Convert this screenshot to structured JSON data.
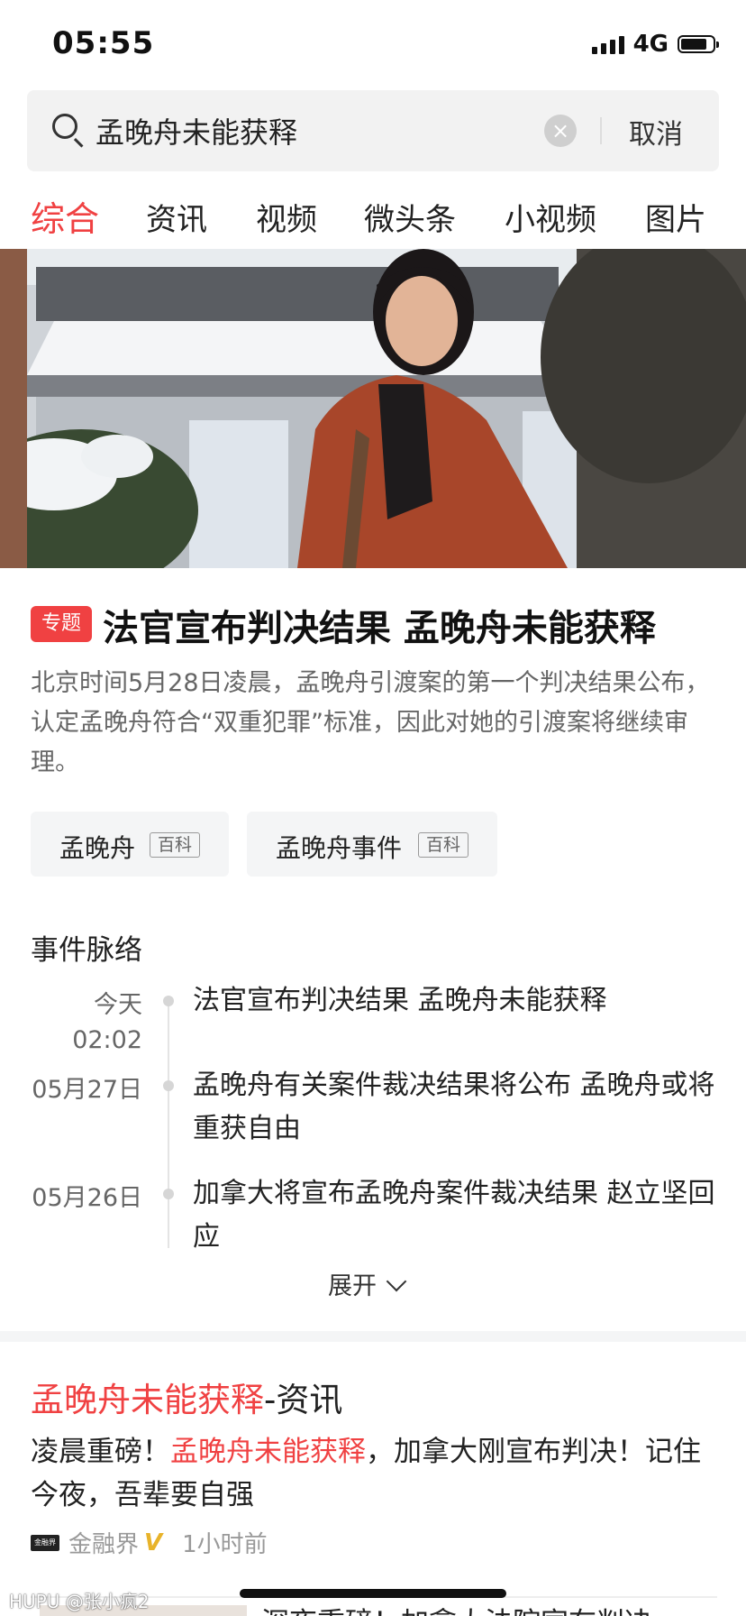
{
  "status_bar": {
    "time": "05:55",
    "network": "4G"
  },
  "search": {
    "query": "孟晚舟未能获释",
    "clear_glyph": "×",
    "cancel_label": "取消"
  },
  "tabs": [
    {
      "label": "综合",
      "active": true
    },
    {
      "label": "资讯",
      "active": false
    },
    {
      "label": "视频",
      "active": false
    },
    {
      "label": "微头条",
      "active": false
    },
    {
      "label": "小视频",
      "active": false
    },
    {
      "label": "图片",
      "active": false
    }
  ],
  "topic": {
    "tag": "专题",
    "title": "法官宣布判决结果 孟晚舟未能获释",
    "summary": "北京时间5月28日凌晨，孟晚舟引渡案的第一个判决结果公布，认定孟晚舟符合“双重犯罪”标准，因此对她的引渡案将继续审理。",
    "chips": [
      {
        "name": "孟晚舟",
        "badge": "百科"
      },
      {
        "name": "孟晚舟事件",
        "badge": "百科"
      }
    ]
  },
  "timeline": {
    "header": "事件脉络",
    "items": [
      {
        "date": "今天",
        "time": "02:02",
        "text": "法官宣布判决结果 孟晚舟未能获释"
      },
      {
        "date": "05月27日",
        "time": "",
        "text": "孟晚舟有关案件裁决结果将公布 孟晚舟或将重获自由"
      },
      {
        "date": "05月26日",
        "time": "",
        "text": "加拿大将宣布孟晚舟案件裁决结果 赵立坚回应"
      }
    ],
    "expand_label": "展开"
  },
  "news": {
    "title_keyword": "孟晚舟未能获释",
    "title_suffix": "-资讯",
    "headline_prefix": "凌晨重磅！",
    "headline_keyword": "孟晚舟未能获释",
    "headline_suffix": "，加拿大刚宣布判决！记住今夜，吾辈要自强",
    "source": "金融界",
    "verified_mark": "V",
    "time_ago": "1小时前",
    "logo_text": "金融界"
  },
  "next_item_peek": "深夜重磅！加拿大法院宣布判决",
  "watermark": "HUPU @张小疯2",
  "colors": {
    "accent": "#f04142",
    "text": "#222222",
    "muted": "#666666"
  }
}
